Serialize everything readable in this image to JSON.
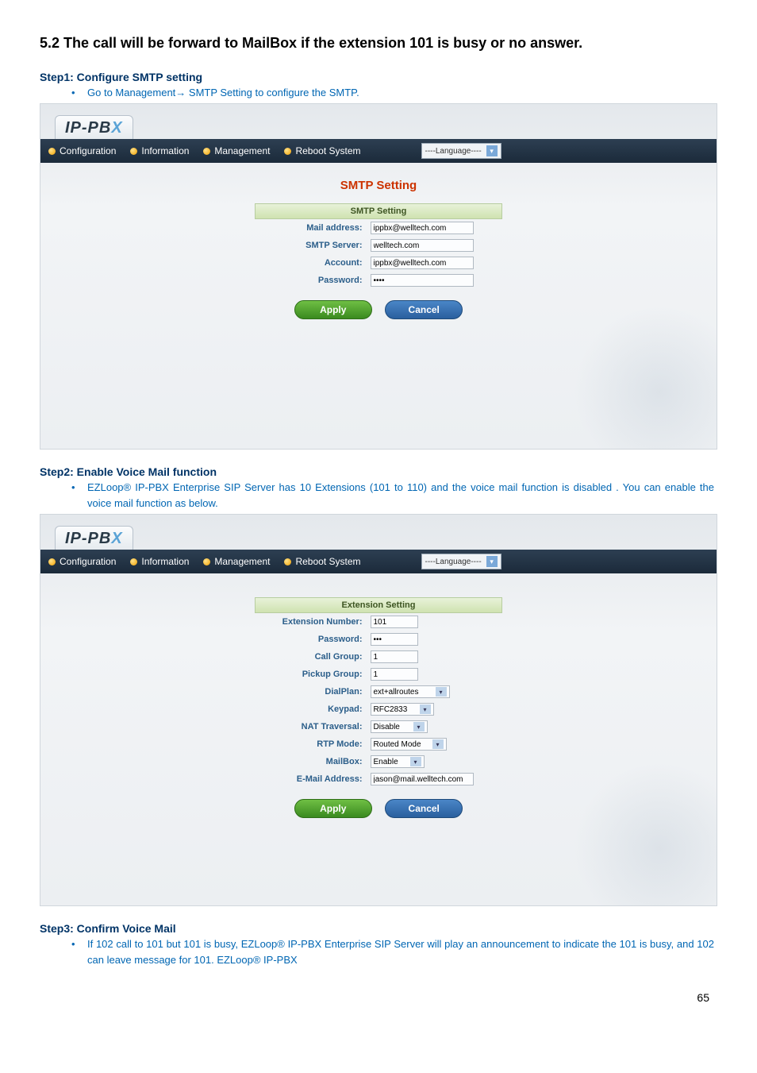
{
  "heading": "5.2 The call will be forward to MailBox if the extension 101 is busy or no answer.",
  "step1": {
    "title": "Step1: Configure SMTP setting",
    "bullet": "Go to Management→ SMTP Setting to configure the SMTP."
  },
  "nav": {
    "configuration": "Configuration",
    "information": "Information",
    "management": "Management",
    "reboot": "Reboot System",
    "language": "----Language----"
  },
  "logo_prefix": "IP-PB",
  "logo_suffix": "X",
  "smtp": {
    "panel_title": "SMTP Setting",
    "box_title": "SMTP Setting",
    "mail_address_label": "Mail address:",
    "mail_address_value": "ippbx@welltech.com",
    "smtp_server_label": "SMTP Server:",
    "smtp_server_value": "welltech.com",
    "account_label": "Account:",
    "account_value": "ippbx@welltech.com",
    "password_label": "Password:",
    "password_value": "••••"
  },
  "buttons": {
    "apply": "Apply",
    "cancel": "Cancel"
  },
  "step2": {
    "title": "Step2: Enable Voice Mail function",
    "bullet": "EZLoop® IP-PBX Enterprise SIP Server has 10 Extensions (101 to 110) and the voice mail function is disabled . You can enable the voice mail function as below."
  },
  "ext": {
    "box_title": "Extension Setting",
    "number_label": "Extension Number:",
    "number_value": "101",
    "password_label": "Password:",
    "password_value": "•••",
    "callgroup_label": "Call Group:",
    "callgroup_value": "1",
    "pickup_label": "Pickup Group:",
    "pickup_value": "1",
    "dialplan_label": "DialPlan:",
    "dialplan_value": "ext+allroutes",
    "keypad_label": "Keypad:",
    "keypad_value": "RFC2833",
    "nat_label": "NAT Traversal:",
    "nat_value": "Disable",
    "rtp_label": "RTP Mode:",
    "rtp_value": "Routed Mode",
    "mailbox_label": "MailBox:",
    "mailbox_value": "Enable",
    "email_label": "E-Mail Address:",
    "email_value": "jason@mail.welltech.com"
  },
  "step3": {
    "title": "Step3: Confirm Voice Mail",
    "bullet": "If 102 call to 101 but 101 is busy, EZLoop® IP-PBX Enterprise SIP Server will play an announcement to indicate the 101 is busy, and 102 can leave message for 101. EZLoop® IP-PBX"
  },
  "page_number": "65"
}
